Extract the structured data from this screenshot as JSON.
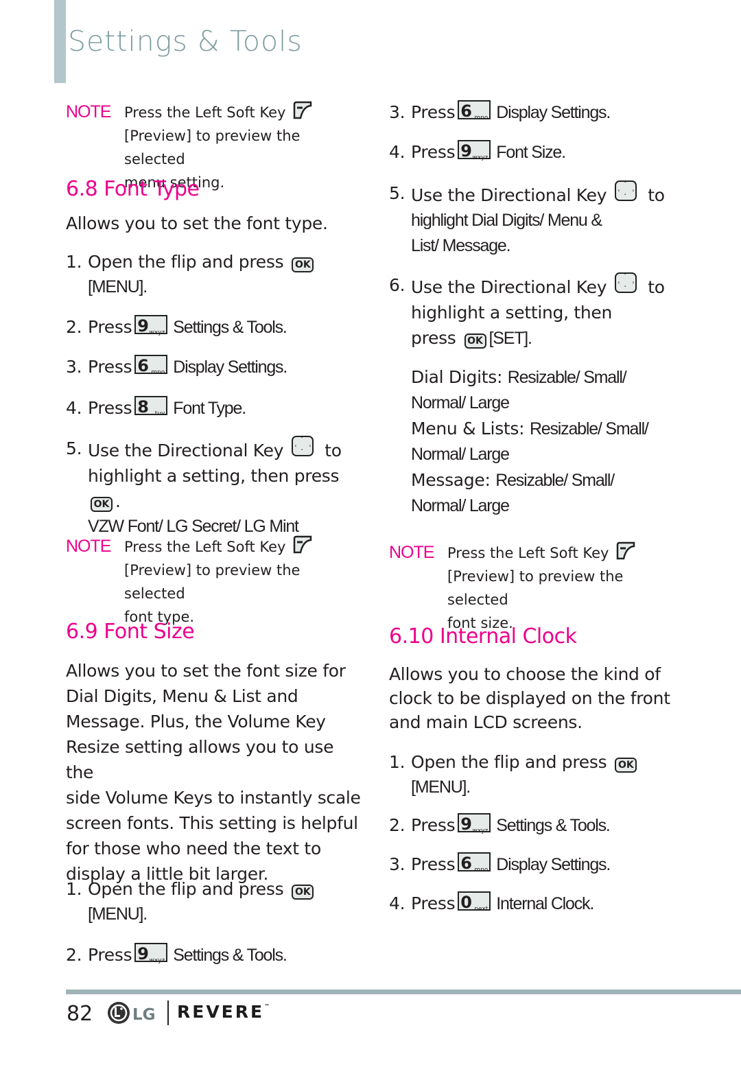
{
  "header": {
    "title": "Settings & Tools"
  },
  "left": {
    "note1": {
      "label": "NOTE",
      "lines": [
        "Press the Left Soft Key",
        "[Preview] to preview the selected",
        "menu setting."
      ]
    },
    "font_type": {
      "heading": "6.8 Font Type",
      "intro": "Allows you to set the font type.",
      "steps": [
        {
          "num": "1.",
          "text": "Open the flip and press",
          "key": "OK",
          "cont": "[MENU]."
        },
        {
          "num": "2.",
          "text": "Press",
          "key_digit": "9",
          "key_letters": "wxyz",
          "action": "Settings & Tools."
        },
        {
          "num": "3.",
          "text": "Press",
          "key_digit": "6",
          "key_letters": "mno",
          "action": "Display Settings."
        },
        {
          "num": "4.",
          "text": "Press",
          "key_digit": "8",
          "key_letters": "tuv",
          "action": "Font Type."
        },
        {
          "num": "5.",
          "line1": "Use the Directional Key",
          "line1_end": "to",
          "line2": "highlight a setting, then press",
          "key": "OK",
          "line3": "VZW Font/  LG Secret/  LG Mint"
        }
      ]
    },
    "note2": {
      "label": "NOTE",
      "lines": [
        "Press the Left Soft Key",
        "[Preview] to preview the selected",
        "font type."
      ]
    },
    "font_size": {
      "heading": "6.9 Font Size",
      "intro_lines": [
        "Allows you to set the font size for",
        "Dial Digits, Menu & List and",
        "Message. Plus, the Volume Key",
        "Resize setting allows you to use the",
        "side Volume Keys to instantly scale",
        "screen fonts. This setting is helpful",
        "for those who need the text to",
        "display a little bit larger."
      ],
      "steps": [
        {
          "num": "1.",
          "text": "Open the flip and press",
          "key": "OK",
          "cont": "[MENU]."
        },
        {
          "num": "2.",
          "text": "Press",
          "key_digit": "9",
          "key_letters": "wxyz",
          "action": "Settings & Tools."
        }
      ]
    }
  },
  "right": {
    "font_size_cont": {
      "steps": [
        {
          "num": "3.",
          "text": "Press",
          "key_digit": "6",
          "key_letters": "mno",
          "action": "Display Settings."
        },
        {
          "num": "4.",
          "text": "Press",
          "key_digit": "9",
          "key_letters": "wxyz",
          "action": "Font Size."
        },
        {
          "num": "5.",
          "line1": "Use the Directional Key",
          "line1_end": "to",
          "line2": "highlight Dial Digits/  Menu &",
          "line3": "List/  Message."
        },
        {
          "num": "6.",
          "line1": "Use the Directional Key",
          "line1_end": "to",
          "line2": "highlight a setting, then",
          "line3_pre": "press",
          "key": "OK",
          "line3_post": "[SET]."
        }
      ],
      "options": [
        {
          "label": "Dial Digits:",
          "values": "Resizable/  Small/",
          "values2": "Normal/  Large"
        },
        {
          "label": "Menu & Lists:",
          "values": "Resizable/  Small/",
          "values2": "Normal/  Large"
        },
        {
          "label": "Message:",
          "values": "Resizable/  Small/",
          "values2": "Normal/  Large"
        }
      ]
    },
    "note3": {
      "label": "NOTE",
      "lines": [
        "Press the Left Soft Key",
        "[Preview] to preview the selected",
        "font size."
      ]
    },
    "internal_clock": {
      "heading": "6.10 Internal Clock",
      "intro_lines": [
        "Allows you to choose the kind of",
        "clock to be displayed on the front",
        "and main  LCD screens."
      ],
      "steps": [
        {
          "num": "1.",
          "text": "Open the flip and press",
          "key": "OK",
          "cont": "[MENU]."
        },
        {
          "num": "2.",
          "text": "Press",
          "key_digit": "9",
          "key_letters": "wxyz",
          "action": "Settings & Tools."
        },
        {
          "num": "3.",
          "text": "Press",
          "key_digit": "6",
          "key_letters": "mno",
          "action": "Display Settings."
        },
        {
          "num": "4.",
          "text": "Press",
          "key_digit": "0",
          "key_letters": "next",
          "action": "Internal Clock."
        }
      ]
    }
  },
  "footer": {
    "page_number": "82",
    "brand": "LG",
    "model": "REVERE",
    "tm": "™"
  },
  "colors": {
    "accent": "#ec008c",
    "header_text": "#7f9d9f",
    "header_bar": "#b3c6cc",
    "rule": "#9fb5b5"
  }
}
